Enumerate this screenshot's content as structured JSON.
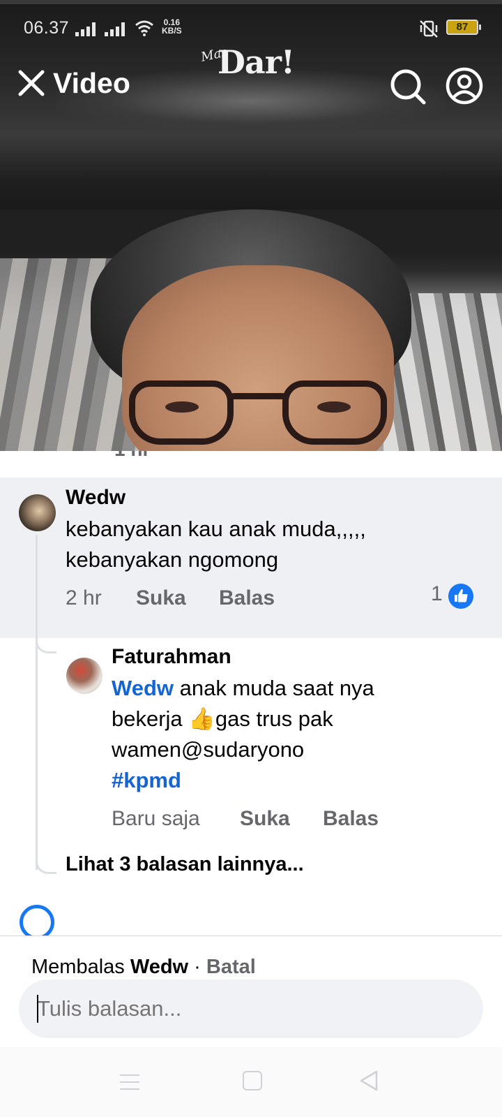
{
  "status_bar": {
    "time": "06.37",
    "net_speed_value": "0.16",
    "net_speed_unit": "KB/S",
    "battery": "87"
  },
  "video_header": {
    "title": "Video",
    "logo_small": "Mas",
    "logo_big": "Dar!"
  },
  "comments": [
    {
      "author": "Wedw",
      "text_line1": "kebanyakan kau anak muda,,,,,",
      "text_line2": "kebanyakan ngomong",
      "time": "2 hr",
      "like_label": "Suka",
      "reply_label": "Balas",
      "reaction_count": "1"
    },
    {
      "author": "Faturahman",
      "mention": "Wedw",
      "text_line1": " anak muda saat nya",
      "text_line2": "bekerja 👍gas trus pak",
      "text_line3": "wamen@sudaryono",
      "hashtag": "#kpmd",
      "time": "Baru saja",
      "like_label": "Suka",
      "reply_label": "Balas"
    }
  ],
  "more_replies": "Lihat 3 balasan lainnya...",
  "reply_bar": {
    "prefix": "Membalas",
    "replying_to": "Wedw",
    "separator": "·",
    "cancel": "Batal",
    "placeholder": "Tulis balasan..."
  },
  "colors": {
    "link": "#1464d2",
    "like_badge": "#1877f2",
    "secondary_text": "#65676b",
    "highlight_bg": "#eef0f4"
  }
}
